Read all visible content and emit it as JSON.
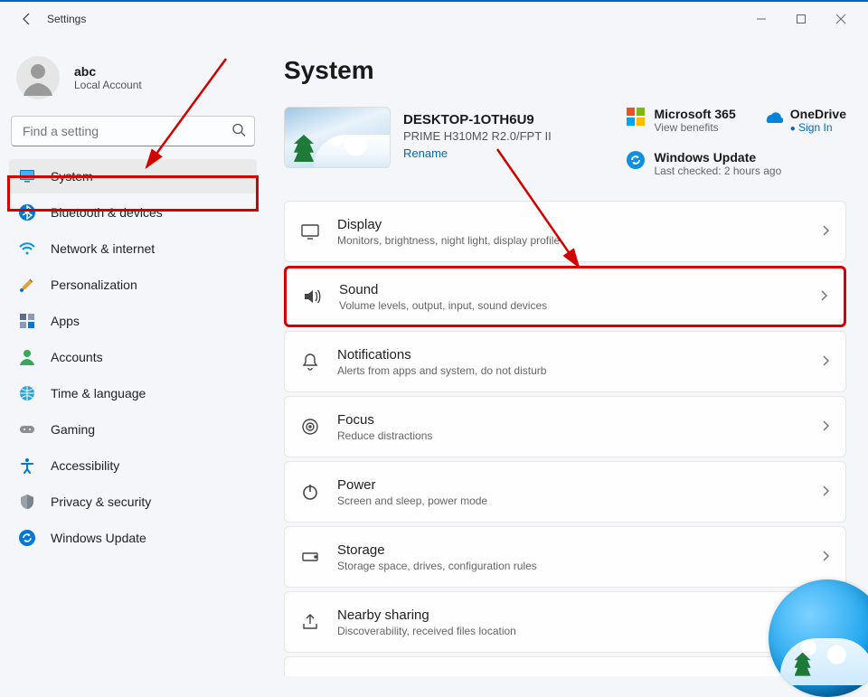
{
  "window": {
    "title": "Settings"
  },
  "account": {
    "name": "abc",
    "sub": "Local Account"
  },
  "search": {
    "placeholder": "Find a setting"
  },
  "sidebar": {
    "items": [
      {
        "label": "System"
      },
      {
        "label": "Bluetooth & devices"
      },
      {
        "label": "Network & internet"
      },
      {
        "label": "Personalization"
      },
      {
        "label": "Apps"
      },
      {
        "label": "Accounts"
      },
      {
        "label": "Time & language"
      },
      {
        "label": "Gaming"
      },
      {
        "label": "Accessibility"
      },
      {
        "label": "Privacy & security"
      },
      {
        "label": "Windows Update"
      }
    ]
  },
  "page": {
    "title": "System"
  },
  "device": {
    "name": "DESKTOP-1OTH6U9",
    "sub": "PRIME H310M2 R2.0/FPT II",
    "rename": "Rename"
  },
  "tiles": {
    "m365": {
      "title": "Microsoft 365",
      "sub": "View benefits"
    },
    "onedrive": {
      "title": "OneDrive",
      "sub": "Sign In"
    },
    "wupdate": {
      "title": "Windows Update",
      "sub": "Last checked: 2 hours ago"
    }
  },
  "cards": [
    {
      "title": "Display",
      "sub": "Monitors, brightness, night light, display profile"
    },
    {
      "title": "Sound",
      "sub": "Volume levels, output, input, sound devices"
    },
    {
      "title": "Notifications",
      "sub": "Alerts from apps and system, do not disturb"
    },
    {
      "title": "Focus",
      "sub": "Reduce distractions"
    },
    {
      "title": "Power",
      "sub": "Screen and sleep, power mode"
    },
    {
      "title": "Storage",
      "sub": "Storage space, drives, configuration rules"
    },
    {
      "title": "Nearby sharing",
      "sub": "Discoverability, received files location"
    }
  ]
}
